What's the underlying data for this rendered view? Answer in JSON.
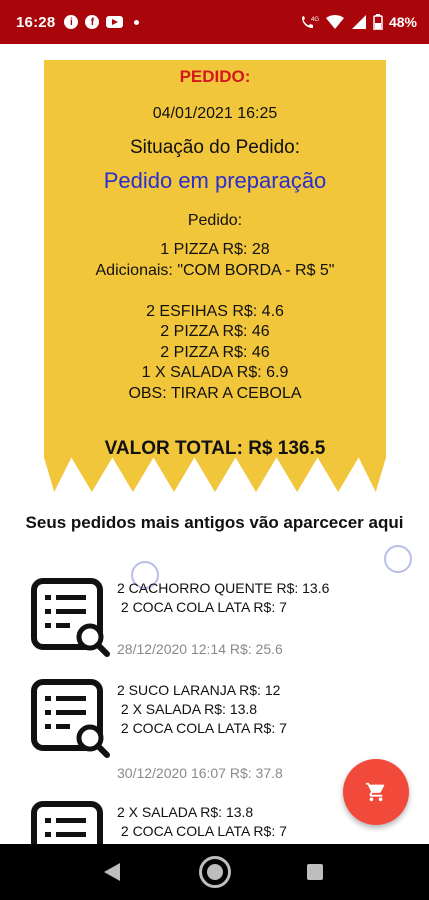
{
  "status_bar": {
    "time": "16:28",
    "battery": "48%",
    "network_badge": "4G",
    "icons": [
      "info-icon",
      "facebook-icon",
      "youtube-icon",
      "notification-dot-icon",
      "phone-4g-icon",
      "wifi-icon",
      "signal-icon",
      "battery-icon"
    ],
    "color": "#a8060a"
  },
  "receipt": {
    "title": "PEDIDO:",
    "datetime": "04/01/2021 16:25",
    "situation_label": "Situação do Pedido:",
    "status": "Pedido em preparação",
    "order_label": "Pedido:",
    "lines": [
      "1 PIZZA R$: 28",
      "Adicionais: \"COM BORDA  -  R$ 5\"",
      "",
      "2 ESFIHAS R$: 4.6",
      "2 PIZZA R$: 46",
      "2 PIZZA R$: 46",
      "1 X SALADA R$: 6.9",
      "OBS: TIRAR A CEBOLA"
    ],
    "total": "VALOR TOTAL: R$  136.5",
    "background": "#f2c63a",
    "title_color": "#d3191f",
    "status_color": "#2a2fcf"
  },
  "old_orders": {
    "heading": "Seus pedidos mais antigos vão aparcecer aqui",
    "items": [
      {
        "lines": "2 CACHORRO QUENTE R$: 13.6\n 2 COCA COLA LATA R$: 7",
        "meta": "28/12/2020 12:14 R$: 25.6"
      },
      {
        "lines": "2 SUCO LARANJA R$: 12\n 2 X SALADA R$: 13.8\n 2 COCA COLA LATA R$: 7",
        "meta": "30/12/2020 16:07 R$: 37.8"
      },
      {
        "lines": "2 X SALADA R$: 13.8\n 2 COCA COLA LATA R$: 7",
        "meta": ""
      }
    ],
    "icon": "order-list-search-icon"
  },
  "fab": {
    "icon": "cart-icon",
    "color": "#f14a3b"
  },
  "nav_bar": {
    "icons": [
      "back-icon",
      "home-icon",
      "recents-icon"
    ]
  }
}
